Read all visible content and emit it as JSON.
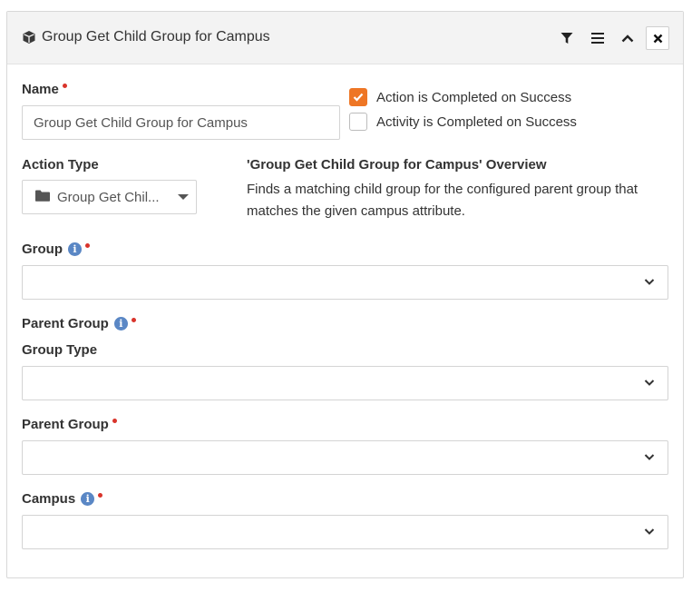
{
  "header": {
    "title": "Group Get Child Group for Campus",
    "icons": [
      "cube-icon",
      "filter-icon",
      "menu-icon",
      "chevron-up-icon",
      "close-icon"
    ]
  },
  "form": {
    "name": {
      "label": "Name",
      "value": "Group Get Child Group for Campus"
    },
    "checkboxes": [
      {
        "label": "Action is Completed on Success",
        "checked": true
      },
      {
        "label": "Activity is Completed on Success",
        "checked": false
      }
    ],
    "action_type": {
      "label": "Action Type",
      "value": "Group Get Chil..."
    },
    "overview": {
      "title": "'Group Get Child Group for Campus' Overview",
      "text": "Finds a matching child group for the configured parent group that matches the given campus attribute."
    },
    "group": {
      "label": "Group"
    },
    "parent_group_section": {
      "label": "Parent Group"
    },
    "group_type": {
      "label": "Group Type"
    },
    "parent_group": {
      "label": "Parent Group"
    },
    "campus": {
      "label": "Campus"
    }
  },
  "colors": {
    "accent": "#ee7625",
    "required": "#d9342b",
    "info": "#5a87c5"
  }
}
